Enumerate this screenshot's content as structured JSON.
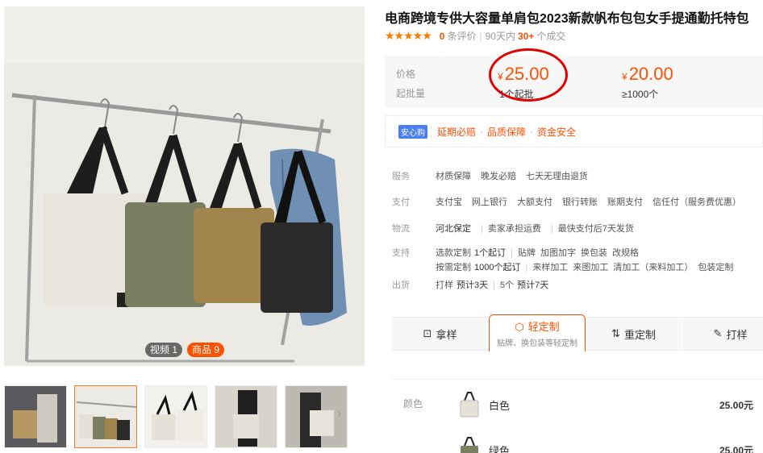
{
  "product": {
    "title": "电商跨境专供大容量单肩包2023新款帆布包包女手提通勤托特包",
    "stars": "★★★★★",
    "review_count": "0",
    "review_label": "条评价",
    "sales_period": "90天内",
    "sales_count": "30+",
    "sales_label": "个成交"
  },
  "gallery": {
    "video_badge": "视频 1",
    "goods_badge": "商品 9",
    "next_icon": "›",
    "thumbnail_count": 5,
    "active_thumbnail": 2
  },
  "pricing": {
    "price_label": "价格",
    "moq_label": "起批量",
    "tiers": [
      {
        "currency": "¥",
        "price": "25.00",
        "qty": "1个起批"
      },
      {
        "currency": "¥",
        "price": "20.00",
        "qty": "≥1000个"
      }
    ],
    "highlight_color": "#e00000",
    "accent_color": "#ff5000"
  },
  "guarantee": {
    "tag": "安心购",
    "items": [
      "延期必赔",
      "品质保障",
      "资金安全"
    ]
  },
  "specs": [
    {
      "label": "服务",
      "values": [
        "材质保障",
        "晚发必赔",
        "七天无理由退货"
      ]
    },
    {
      "label": "支付",
      "values": [
        "支付宝",
        "网上银行",
        "大额支付",
        "银行转账",
        "账期支付",
        "信任付（服务费优惠）"
      ]
    },
    {
      "label": "物流",
      "values": [
        "河北保定",
        "卖家承担运费",
        "最快支付后7天发货"
      ]
    },
    {
      "label": "支持",
      "line1_key": "选款定制",
      "line1_moq": "1个起订",
      "line1_values": [
        "贴牌",
        "加图加字",
        "换包装",
        "改规格"
      ],
      "line2_key": "按需定制",
      "line2_moq": "1000个起订",
      "line2_values": [
        "来样加工",
        "来图加工",
        "清加工（来料加工）",
        "包装定制"
      ]
    },
    {
      "label": "出货",
      "values": [
        "打样",
        "预计3天",
        "5个",
        "预计7天"
      ]
    }
  ],
  "tabs": [
    {
      "icon": "⊡",
      "label": "拿样"
    },
    {
      "icon": "⬡",
      "label": "轻定制",
      "sub": "贴牌、换包装等轻定制"
    },
    {
      "icon": "⇅",
      "label": "重定制"
    },
    {
      "icon": "✎",
      "label": "打样"
    }
  ],
  "sku": {
    "label": "颜色",
    "items": [
      {
        "name": "白色",
        "price": "25.00元"
      },
      {
        "name": "绿色",
        "price": "25.00元"
      }
    ]
  }
}
